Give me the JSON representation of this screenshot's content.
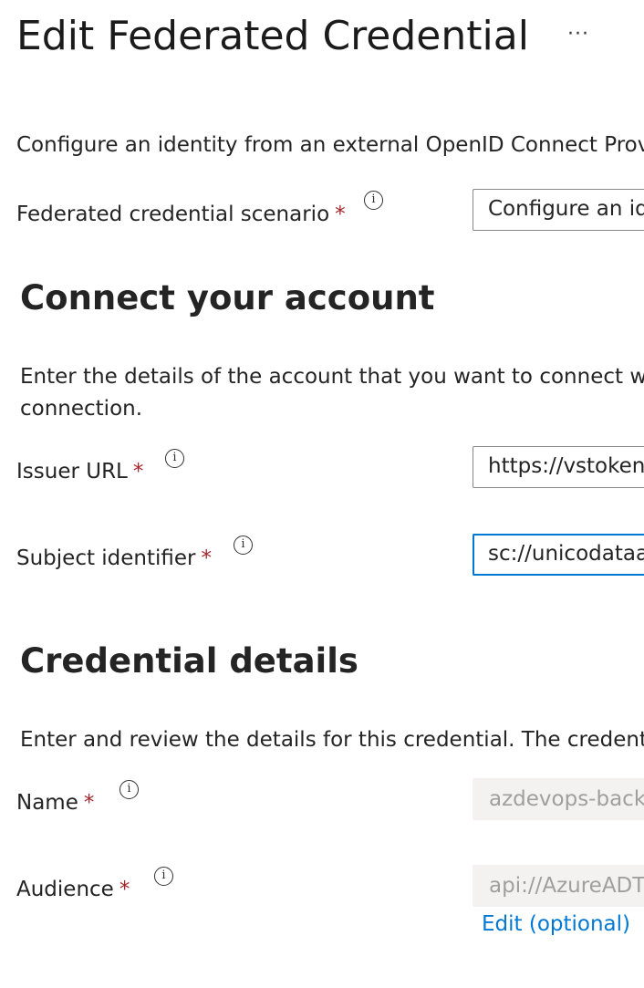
{
  "header": {
    "title": "Edit Federated Credential",
    "more_label": "···"
  },
  "intro": "Configure an identity from an external OpenID Connect Prov",
  "scenario": {
    "label": "Federated credential scenario",
    "required": "*",
    "value": "Configure an id"
  },
  "connect": {
    "heading": "Connect your account",
    "description_line1": "Enter the details of the account that you want to connect wi",
    "description_line2": "connection.",
    "issuer": {
      "label": "Issuer URL",
      "required": "*",
      "value": "https://vstoken"
    },
    "subject": {
      "label": "Subject identifier",
      "required": "*",
      "value": "sc://unicodataa"
    }
  },
  "details": {
    "heading": "Credential details",
    "description": "Enter and review the details for this credential. The credentia",
    "name": {
      "label": "Name",
      "required": "*",
      "value": "azdevops-back"
    },
    "audience": {
      "label": "Audience",
      "required": "*",
      "value": "api://AzureADT",
      "edit_link": "Edit (optional)"
    }
  },
  "icons": {
    "info": "info-icon",
    "more": "more-horizontal-icon"
  },
  "colors": {
    "accent": "#0078d4",
    "required": "#a4262c",
    "disabled_bg": "#f3f2f1",
    "border": "#8a8886"
  }
}
